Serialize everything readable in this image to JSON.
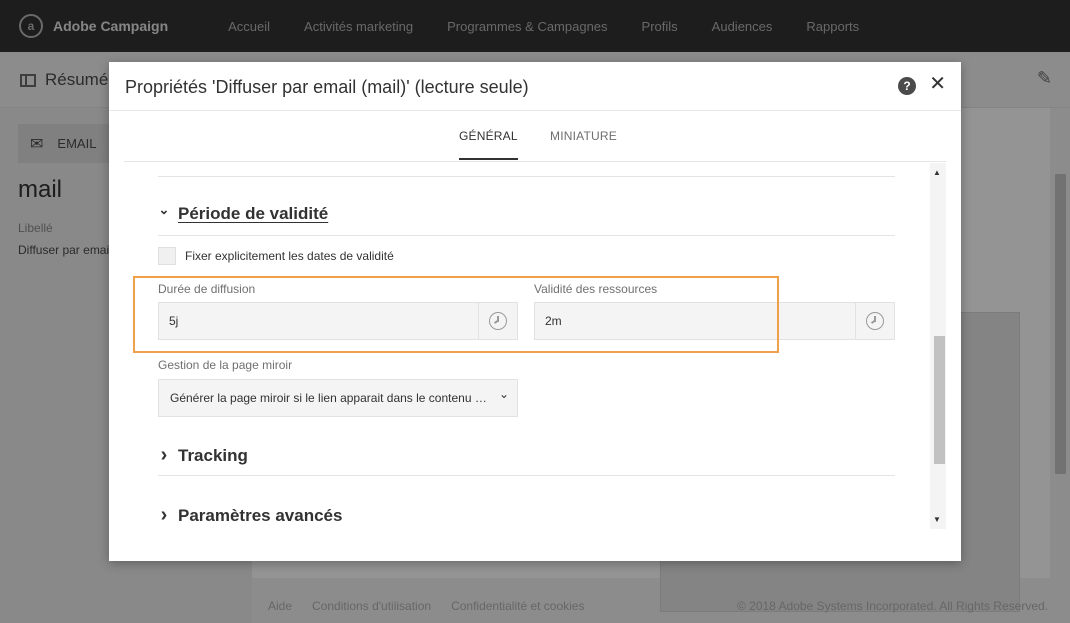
{
  "app": {
    "name": "Adobe Campaign",
    "logo_glyph": "a",
    "nav": [
      "Accueil",
      "Activités marketing",
      "Programmes & Campagnes",
      "Profils",
      "Audiences",
      "Rapports"
    ]
  },
  "background": {
    "header_title": "Résumé",
    "email_label": "EMAIL",
    "delivery_name": "mail",
    "libelle_label": "Libellé",
    "libelle_value": "Diffuser par email",
    "footer": {
      "aide": "Aide",
      "conditions": "Conditions d'utilisation",
      "confidentialite": "Confidentialité et cookies",
      "copyright": "© 2018 Adobe Systems Incorporated. All Rights Reserved."
    }
  },
  "modal": {
    "title": "Propriétés 'Diffuser par email (mail)' (lecture seule)",
    "help_glyph": "?",
    "close_glyph": "✕",
    "tabs": [
      {
        "label": "GÉNÉRAL",
        "active": true
      },
      {
        "label": "MINIATURE",
        "active": false
      }
    ],
    "sections": {
      "validity": {
        "title": "Période de validité",
        "expanded": true,
        "checkbox_label": "Fixer explicitement les dates de validité",
        "checkbox_checked": false,
        "duree_label": "Durée de diffusion",
        "duree_value": "5j",
        "validite_label": "Validité des ressources",
        "validite_value": "2m",
        "mirror_label": "Gestion de la page miroir",
        "mirror_value": "Générer la page miroir si le lien apparait dans le contenu du message"
      },
      "tracking": {
        "title": "Tracking",
        "expanded": false
      },
      "advanced": {
        "title": "Paramètres avancés",
        "expanded": false
      }
    },
    "highlight_color": "#f0a04b"
  },
  "icons": {
    "clock": "clock-icon",
    "chevron_down": "⌄",
    "chevron_right": "›",
    "scroll_up": "▲",
    "scroll_down": "▼",
    "envelope": "✉",
    "pencil": "✎"
  }
}
